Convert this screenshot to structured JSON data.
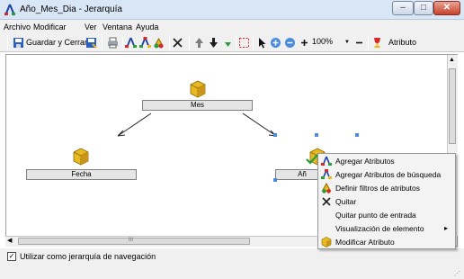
{
  "window": {
    "title": "Año_Mes_Dia - Jerarquía",
    "controls": {
      "minimize": "–",
      "maximize": "□",
      "close": "✕"
    }
  },
  "menubar": {
    "items": [
      "Archivo",
      "Modificar",
      "Ver",
      "Ventana",
      "Ayuda"
    ]
  },
  "toolbar": {
    "save_close_label": "Guardar y Cerrar",
    "zoom_value": "100%",
    "attribute_label": "Atributo"
  },
  "canvas": {
    "nodes": [
      {
        "label": "Mes"
      },
      {
        "label": "Fecha"
      },
      {
        "label": "Añ"
      }
    ],
    "hscroll_grip": "III"
  },
  "context_menu": {
    "items": [
      {
        "label": "Agregar Atributos",
        "icon": "hierarchy-icon"
      },
      {
        "label": "Agregar Atributos de búsqueda",
        "icon": "hierarchy-lookup-icon"
      },
      {
        "label": "Definir filtros de atributos",
        "icon": "filter-icon"
      },
      {
        "label": "Quitar",
        "icon": "x-icon"
      },
      {
        "label": "Quitar punto de entrada",
        "icon": ""
      },
      {
        "label": "Visualización de elemento",
        "icon": "",
        "submenu": "▸"
      },
      {
        "label": "Modificar Atributo",
        "icon": "cube-icon"
      }
    ]
  },
  "footer": {
    "nav_checkbox_label": "Utilizar como jerarquía de navegación",
    "nav_checkbox_checked": true
  },
  "colors": {
    "cube_gold": "#e8b923",
    "handle_blue": "#4a8cdb",
    "title_bar": "#d9e6f5",
    "close_red": "#c7412c"
  }
}
